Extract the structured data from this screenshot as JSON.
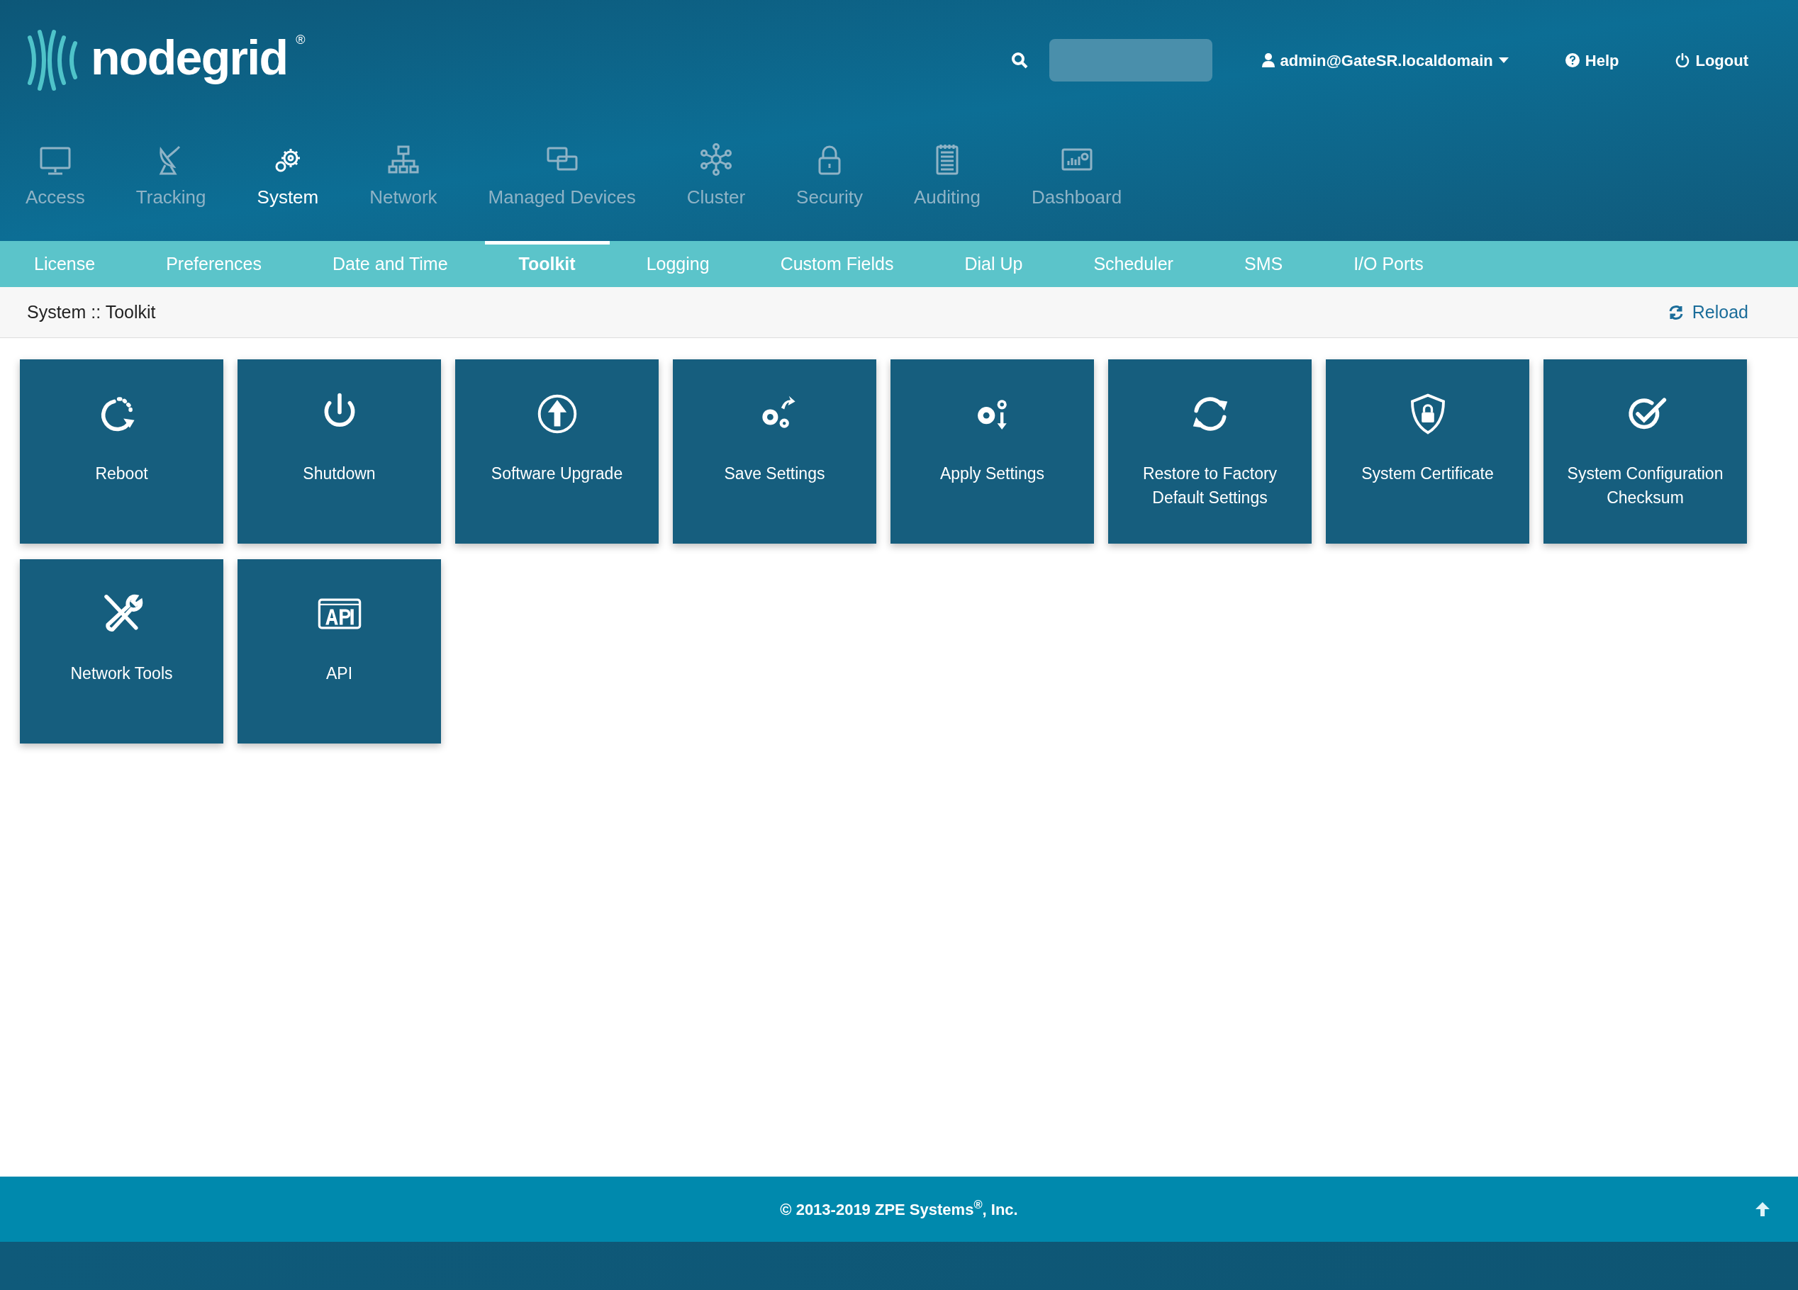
{
  "logo": {
    "text": "nodegrid",
    "mark": "®"
  },
  "user_menu": {
    "label": "admin@GateSR.localdomain"
  },
  "help": {
    "label": "Help"
  },
  "logout": {
    "label": "Logout"
  },
  "main_nav": [
    {
      "label": "Access",
      "selected": false
    },
    {
      "label": "Tracking",
      "selected": false
    },
    {
      "label": "System",
      "selected": true
    },
    {
      "label": "Network",
      "selected": false
    },
    {
      "label": "Managed Devices",
      "selected": false
    },
    {
      "label": "Cluster",
      "selected": false
    },
    {
      "label": "Security",
      "selected": false
    },
    {
      "label": "Auditing",
      "selected": false
    },
    {
      "label": "Dashboard",
      "selected": false
    }
  ],
  "sub_nav": [
    {
      "label": "License",
      "selected": false
    },
    {
      "label": "Preferences",
      "selected": false
    },
    {
      "label": "Date and Time",
      "selected": false
    },
    {
      "label": "Toolkit",
      "selected": true
    },
    {
      "label": "Logging",
      "selected": false
    },
    {
      "label": "Custom Fields",
      "selected": false
    },
    {
      "label": "Dial Up",
      "selected": false
    },
    {
      "label": "Scheduler",
      "selected": false
    },
    {
      "label": "SMS",
      "selected": false
    },
    {
      "label": "I/O Ports",
      "selected": false
    }
  ],
  "breadcrumb": "System :: Toolkit",
  "reload": {
    "label": "Reload"
  },
  "tiles": [
    {
      "label": "Reboot"
    },
    {
      "label": "Shutdown"
    },
    {
      "label": "Software Upgrade"
    },
    {
      "label": "Save Settings"
    },
    {
      "label": "Apply Settings"
    },
    {
      "label": "Restore to Factory Default Settings"
    },
    {
      "label": "System Certificate"
    },
    {
      "label": "System Configuration Checksum"
    },
    {
      "label": "Network Tools"
    },
    {
      "label": "API"
    }
  ],
  "footer": {
    "copyright": "© 2013-2019 ZPE Systems$^{®}$, Inc."
  }
}
